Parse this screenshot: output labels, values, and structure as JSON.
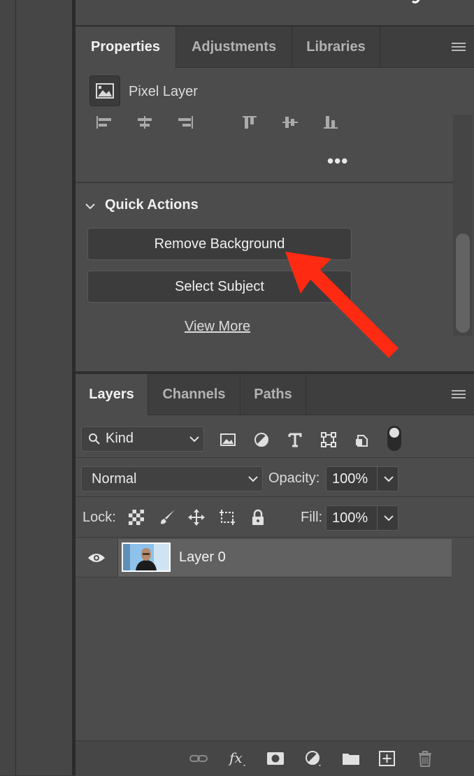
{
  "properties": {
    "tabs": [
      {
        "label": "Properties",
        "active": true
      },
      {
        "label": "Adjustments",
        "active": false
      },
      {
        "label": "Libraries",
        "active": false
      }
    ],
    "layer_type": "Pixel Layer",
    "more_label": "•••",
    "quick_actions": {
      "header": "Quick Actions",
      "buttons": [
        "Remove Background",
        "Select Subject"
      ],
      "view_more": "View More"
    }
  },
  "layers": {
    "tabs": [
      {
        "label": "Layers",
        "active": true
      },
      {
        "label": "Channels",
        "active": false
      },
      {
        "label": "Paths",
        "active": false
      }
    ],
    "filter": {
      "kind_label": "Kind",
      "icons": [
        "image-filter-icon",
        "adjustment-filter-icon",
        "type-filter-icon",
        "shape-filter-icon",
        "smart-object-filter-icon"
      ],
      "toggle_on": true
    },
    "blend_mode": "Normal",
    "opacity_label": "Opacity:",
    "opacity_value": "100%",
    "lock_label": "Lock:",
    "lock_icons": [
      "lock-transparent-pixels-icon",
      "lock-image-pixels-icon",
      "lock-position-icon",
      "lock-artboard-icon",
      "lock-all-icon"
    ],
    "fill_label": "Fill:",
    "fill_value": "100%",
    "items": [
      {
        "name": "Layer 0",
        "visible": true,
        "selected": true
      }
    ],
    "footer_icons": [
      "link-layers-icon",
      "fx-icon",
      "layer-mask-icon",
      "adjustment-layer-icon",
      "group-folder-icon",
      "new-layer-icon",
      "trash-icon"
    ]
  },
  "colors": {
    "panel_bg": "#4c4c4c",
    "tabbar_bg": "#3e3e3e",
    "selected_layer_bg": "#616161",
    "annotation_arrow": "#ff2a12"
  }
}
